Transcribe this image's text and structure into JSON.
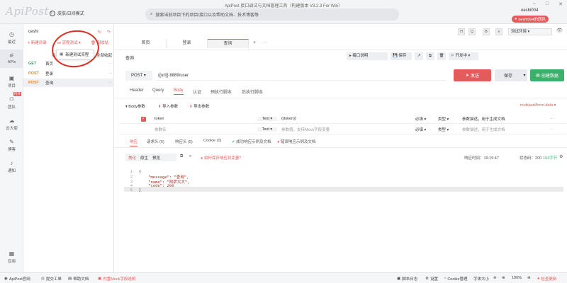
{
  "app": {
    "logo": "ApiPost",
    "theme_label": "皮肤/日间模式",
    "window_title": "ApiPost 接口调试与文档管理工具（构建版本 V3.2.3 For Win）",
    "search_placeholder": "搜索当前项目下的项目/接口以及帮助文档、技术博客等",
    "user_name": "oeshi004",
    "user_badge": "oeshi004的团队"
  },
  "sidebar": {
    "items": [
      {
        "label": "最近",
        "icon": "clock-icon"
      },
      {
        "label": "APIs",
        "icon": "api-icon"
      },
      {
        "label": "项目",
        "icon": "project-icon"
      },
      {
        "label": "团队",
        "icon": "team-icon"
      },
      {
        "label": "云大使",
        "icon": "cloud-icon"
      },
      {
        "label": "博客",
        "icon": "blog-icon"
      },
      {
        "label": "通知",
        "icon": "bell-icon"
      },
      {
        "label": "应用",
        "icon": "apps-icon"
      }
    ],
    "team_badge": "内外"
  },
  "tree": {
    "project": "ceshi",
    "new_dir": "新建目录",
    "flow_test": "流程测试",
    "recycle": "回收站",
    "popup_item": "新建测试流程",
    "all_collapse": "全部收起",
    "rows": [
      {
        "method": "GET",
        "name": "首页"
      },
      {
        "method": "POST",
        "name": "登录"
      },
      {
        "method": "POST",
        "name": "查询"
      }
    ]
  },
  "main": {
    "tabs": [
      "首页",
      "登录",
      "查询"
    ],
    "toolbar_icons": [
      "H",
      "Q",
      "B",
      "≡"
    ],
    "env_label": "测试环境",
    "api_name": "查询",
    "api_toolbar": [
      "接口说明",
      "保存",
      "分享"
    ],
    "dev_status": "开发中",
    "method": "POST",
    "url": "{{url}}:8889/user",
    "send": "发送",
    "save": "保存",
    "mock": "创建数据",
    "subtabs": [
      "Header",
      "Query",
      "Body",
      "认证",
      "预执行脚本",
      "后执行脚本"
    ],
    "body_label": "Body参数",
    "import_param": "导入参数",
    "export_param": "导出参数",
    "content_type": "multipart/form-data",
    "params": [
      {
        "checked": true,
        "key": "token",
        "type": "Text",
        "value": "{{token}}",
        "required": "必填",
        "param_type": "类型",
        "desc": "参数描述，用于生成文档"
      },
      {
        "checked": false,
        "key": "参数名",
        "type": "Text",
        "value": "参数值，支持Mock字段变量",
        "required": "必填",
        "param_type": "类型",
        "desc": "参数描述，用于生成文档"
      }
    ],
    "resp_tabs": [
      "响应",
      "请求头 (6)",
      "响应头 (5)",
      "Cookie (0)",
      "成功响应示例及文档",
      "错误响应示例及文档"
    ],
    "resp_subtabs": [
      "美化",
      "原生",
      "预览"
    ],
    "resp_hint": "如何保存响应到变量?",
    "resp_time": "响应时间：19:15:47",
    "resp_code": "状态码：200",
    "resp_size": "104字节",
    "code_lines": [
      "{",
      "    \"message\": \"查询\",",
      "    \"name\": \"阿萨大大\",",
      "    \"code\": 200",
      "}"
    ]
  },
  "statusbar": {
    "left": [
      "ApiPost官网",
      "提交工单",
      "帮助文档",
      "内置Mock字段说明"
    ],
    "right": [
      "脚本日志",
      "设置",
      "Cookie管理",
      "字体大小",
      "100%",
      "检查更新"
    ]
  }
}
